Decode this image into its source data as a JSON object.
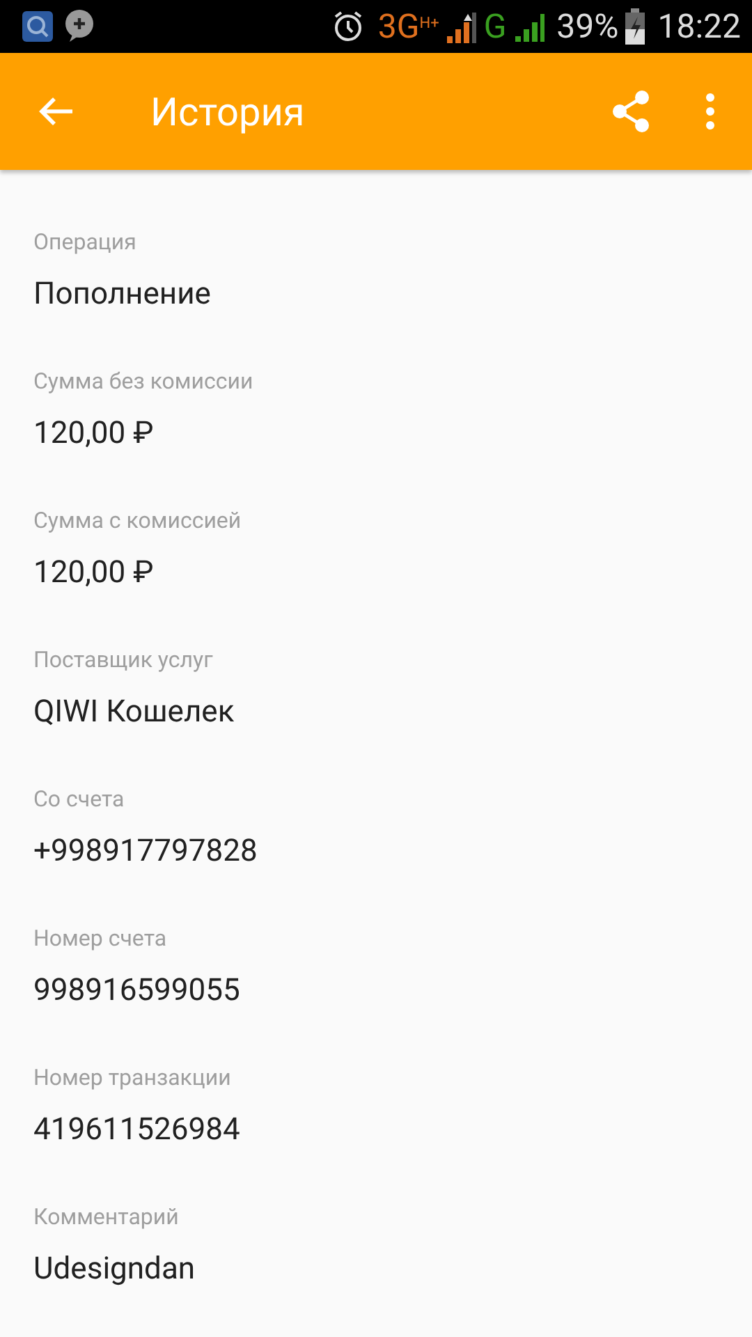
{
  "status_bar": {
    "network_1": "3G",
    "network_1_badge": "H+",
    "network_2": "G",
    "battery": "39%",
    "time": "18:22"
  },
  "app_bar": {
    "title": "История"
  },
  "fields": [
    {
      "label": "Операция",
      "value": "Пополнение"
    },
    {
      "label": "Сумма без комиссии",
      "value": "120,00 ₽"
    },
    {
      "label": "Сумма с комиссией",
      "value": "120,00 ₽"
    },
    {
      "label": "Поставщик услуг",
      "value": "QIWI Кошелек"
    },
    {
      "label": "Со счета",
      "value": "+998917797828"
    },
    {
      "label": "Номер счета",
      "value": "998916599055"
    },
    {
      "label": "Номер транзакции",
      "value": "419611526984"
    },
    {
      "label": "Комментарий",
      "value": "Udesigndan"
    }
  ]
}
